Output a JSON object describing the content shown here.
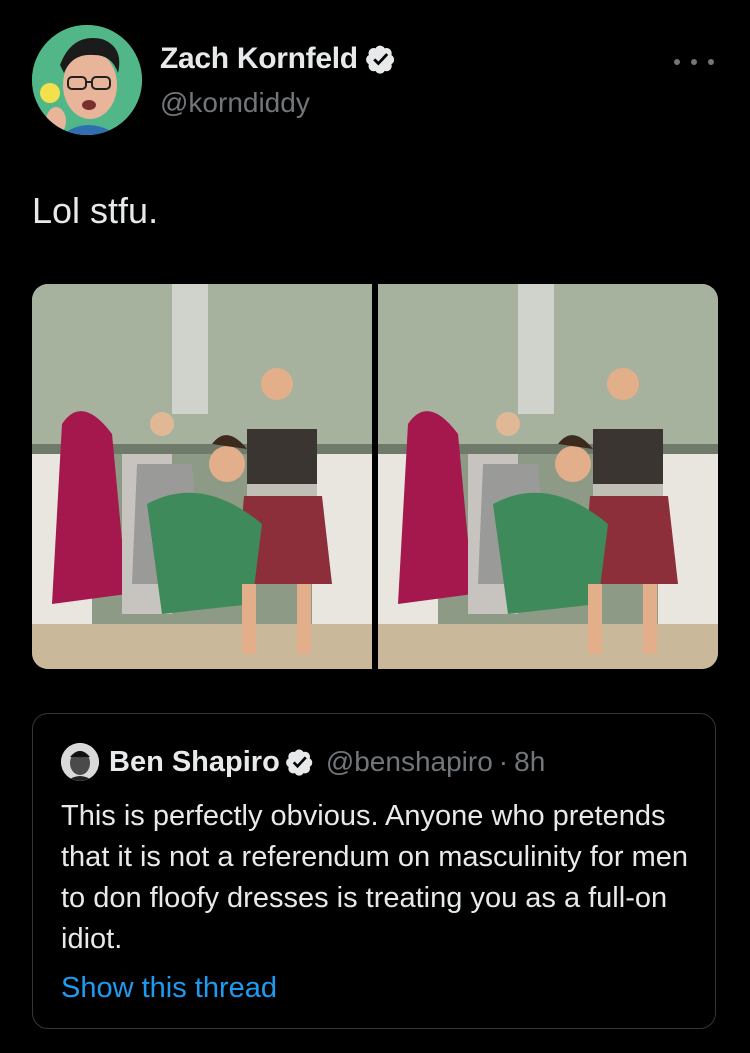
{
  "author": {
    "name": "Zach Kornfeld",
    "handle": "@korndiddy",
    "avatar_icon": "profile-photo",
    "verified_icon": "verified-badge-icon"
  },
  "tweet": {
    "text": "Lol stfu."
  },
  "media": {
    "count": 2,
    "images": [
      "group-photo-1",
      "group-photo-2"
    ]
  },
  "quoted_tweet": {
    "name": "Ben Shapiro",
    "handle": "@benshapiro",
    "separator": "·",
    "time": "8h",
    "text": "This is perfectly obvious. Anyone who pretends that it is not a referendum on masculinity for men to don floofy dresses is treating you as a full-on idiot.",
    "link": "Show this thread"
  },
  "colors": {
    "background": "#000000",
    "text": "#e7e9ea",
    "secondary": "#71767b",
    "link": "#1d9bf0",
    "border": "#333639"
  }
}
